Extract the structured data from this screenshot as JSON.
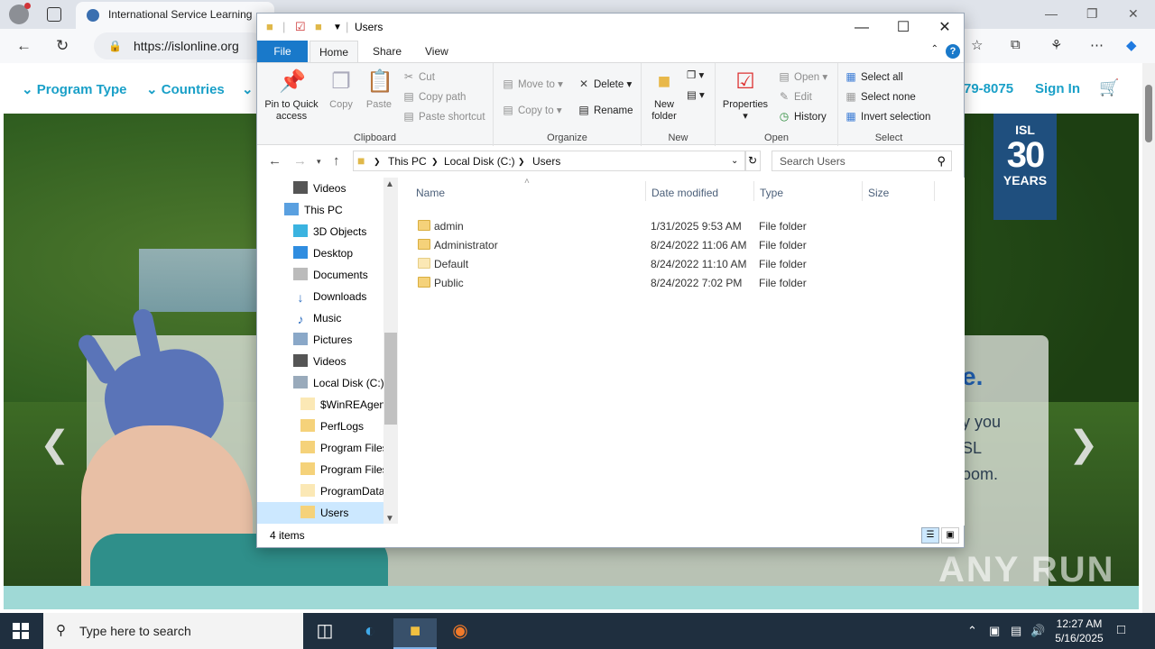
{
  "browser": {
    "tab_title": "International Service Learning",
    "url": "https://islonline.org"
  },
  "site": {
    "nav": {
      "program_type": "Program Type",
      "countries": "Countries",
      "phone": "79-8075",
      "sign_in": "Sign In"
    },
    "badge": {
      "top": "ISL",
      "number": "30",
      "bottom": "YEARS"
    },
    "hero_heading": "e.",
    "hero_lines": [
      "y you",
      "SL",
      "oom."
    ],
    "watermark": "ANY RUN"
  },
  "explorer": {
    "title": "Users",
    "tabs": {
      "file": "File",
      "home": "Home",
      "share": "Share",
      "view": "View"
    },
    "ribbon": {
      "clipboard": {
        "label": "Clipboard",
        "pin": "Pin to Quick access",
        "copy": "Copy",
        "paste": "Paste",
        "cut": "Cut",
        "copy_path": "Copy path",
        "paste_shortcut": "Paste shortcut"
      },
      "organize": {
        "label": "Organize",
        "move_to": "Move to",
        "copy_to": "Copy to",
        "delete": "Delete",
        "rename": "Rename"
      },
      "new": {
        "label": "New",
        "new_folder": "New folder"
      },
      "open": {
        "label": "Open",
        "properties": "Properties",
        "open": "Open",
        "edit": "Edit",
        "history": "History"
      },
      "select": {
        "label": "Select",
        "select_all": "Select all",
        "select_none": "Select none",
        "invert": "Invert selection"
      }
    },
    "path": [
      "This PC",
      "Local Disk (C:)",
      "Users"
    ],
    "search_placeholder": "Search Users",
    "nav_items": [
      "Videos",
      "This PC",
      "3D Objects",
      "Desktop",
      "Documents",
      "Downloads",
      "Music",
      "Pictures",
      "Videos",
      "Local Disk (C:)",
      "$WinREAgent",
      "PerfLogs",
      "Program Files",
      "Program Files",
      "ProgramData",
      "Users"
    ],
    "columns": {
      "name": "Name",
      "date": "Date modified",
      "type": "Type",
      "size": "Size"
    },
    "files": [
      {
        "name": "admin",
        "date": "1/31/2025 9:53 AM",
        "type": "File folder"
      },
      {
        "name": "Administrator",
        "date": "8/24/2022 11:06 AM",
        "type": "File folder"
      },
      {
        "name": "Default",
        "date": "8/24/2022 11:10 AM",
        "type": "File folder"
      },
      {
        "name": "Public",
        "date": "8/24/2022 7:02 PM",
        "type": "File folder"
      }
    ],
    "status": "4 items"
  },
  "taskbar": {
    "search_placeholder": "Type here to search",
    "time": "12:27 AM",
    "date": "5/16/2025"
  }
}
